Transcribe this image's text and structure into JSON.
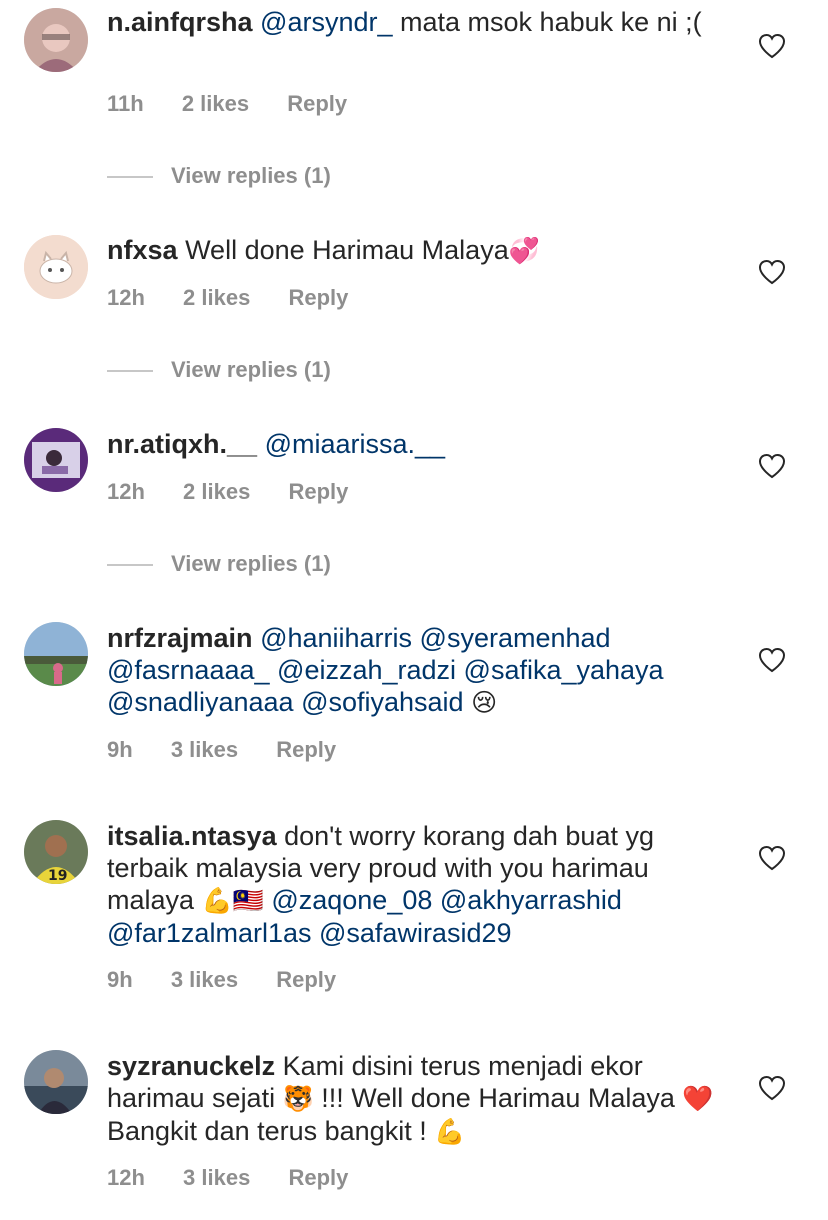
{
  "comments": [
    {
      "username": "n.ainfqrsha",
      "segments": [
        {
          "t": "@arsyndr_",
          "m": true
        },
        {
          "t": " mata msok habuk ke ni ;(",
          "m": false
        }
      ],
      "time": "11h",
      "likes": "2 likes",
      "reply": "Reply",
      "view_replies": "View replies (1)"
    },
    {
      "username": "nfxsa",
      "segments": [
        {
          "t": "Well done Harimau Malaya",
          "m": false
        },
        {
          "t": "💞",
          "e": true
        }
      ],
      "time": "12h",
      "likes": "2 likes",
      "reply": "Reply",
      "view_replies": "View replies (1)"
    },
    {
      "username": "nr.atiqxh.__",
      "segments": [
        {
          "t": "@miaarissa.__",
          "m": true
        }
      ],
      "time": "12h",
      "likes": "2 likes",
      "reply": "Reply",
      "view_replies": "View replies (1)"
    },
    {
      "username": "nrfzrajmain",
      "segments": [
        {
          "t": "@haniiharris",
          "m": true
        },
        {
          "t": " ",
          "m": false
        },
        {
          "t": "@syeramenhad",
          "m": true
        },
        {
          "t": " ",
          "m": false
        },
        {
          "t": "@fasrnaaaa_",
          "m": true
        },
        {
          "t": " ",
          "m": false
        },
        {
          "t": "@eizzah_radzi",
          "m": true
        },
        {
          "t": " ",
          "m": false
        },
        {
          "t": "@safika_yahaya",
          "m": true
        },
        {
          "t": " ",
          "m": false
        },
        {
          "t": "@snadliyanaaa",
          "m": true
        },
        {
          "t": " ",
          "m": false
        },
        {
          "t": "@sofiyahsaid",
          "m": true
        },
        {
          "t": " ",
          "m": false
        },
        {
          "t": "😢",
          "e": true
        }
      ],
      "time": "9h",
      "likes": "3 likes",
      "reply": "Reply",
      "view_replies": ""
    },
    {
      "username": "itsalia.ntasya",
      "segments": [
        {
          "t": "don't worry korang dah buat yg terbaik malaysia very proud with you harimau malaya ",
          "m": false
        },
        {
          "t": "💪🇲🇾",
          "e": true
        },
        {
          "t": "  ",
          "m": false
        },
        {
          "t": "@zaqone_08",
          "m": true
        },
        {
          "t": " ",
          "m": false
        },
        {
          "t": "@akhyarrashid",
          "m": true
        },
        {
          "t": " ",
          "m": false
        },
        {
          "t": "@far1zalmarl1as",
          "m": true
        },
        {
          "t": " ",
          "m": false
        },
        {
          "t": "@safawirasid29",
          "m": true
        }
      ],
      "time": "9h",
      "likes": "3 likes",
      "reply": "Reply",
      "view_replies": ""
    },
    {
      "username": "syzranuckelz",
      "segments": [
        {
          "t": "Kami disini terus menjadi ekor harimau sejati ",
          "m": false
        },
        {
          "t": "🐯",
          "e": true
        },
        {
          "t": " !!! Well done Harimau Malaya ",
          "m": false
        },
        {
          "t": "❤️",
          "e": true
        },
        {
          "t": " Bangkit dan terus bangkit ! ",
          "m": false
        },
        {
          "t": "💪",
          "e": true
        }
      ],
      "time": "12h",
      "likes": "3 likes",
      "reply": "Reply",
      "view_replies": ""
    }
  ],
  "colors": {
    "mention": "#003569",
    "meta": "#8e8e8e",
    "text": "#262626"
  },
  "icons": {
    "like": "heart-outline-icon"
  }
}
